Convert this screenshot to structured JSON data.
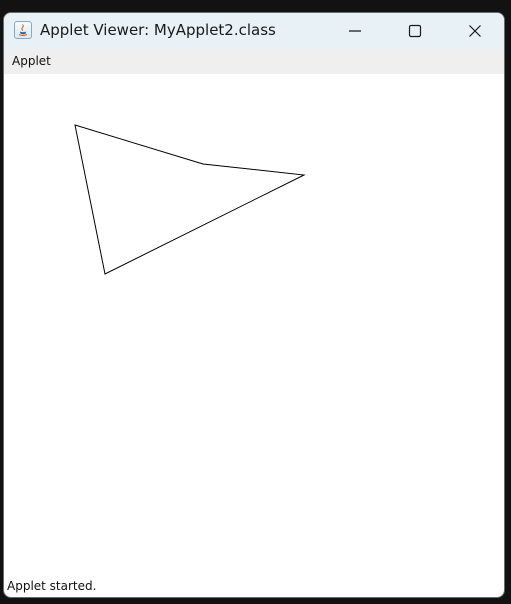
{
  "window": {
    "title": "Applet Viewer: MyApplet2.class",
    "icon": "java-icon"
  },
  "controls": {
    "minimize_icon": "minimize-icon",
    "maximize_icon": "maximize-icon",
    "close_icon": "close-icon"
  },
  "menubar": {
    "items": [
      {
        "label": "Applet"
      }
    ]
  },
  "applet": {
    "shape": "polygon",
    "stroke_color": "#000000",
    "background_color": "#ffffff"
  },
  "status": {
    "text": "Applet started."
  }
}
